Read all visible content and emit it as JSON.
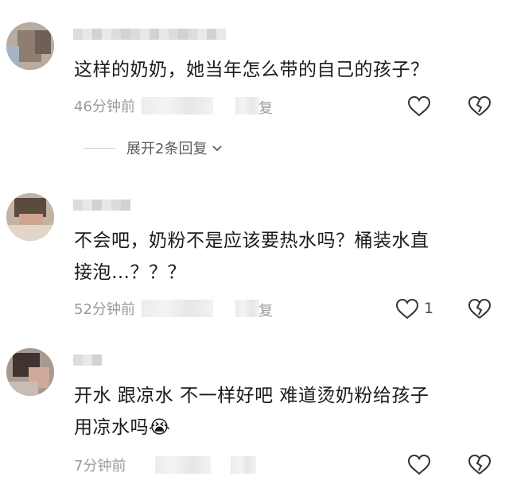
{
  "comments": [
    {
      "text_lines": [
        "这样的奶奶，她当年怎么带的自己的孩子？"
      ],
      "time": "46分钟前",
      "reply_tail": "复",
      "like_count": "",
      "expand_label": "展开2条回复"
    },
    {
      "text_lines": [
        "不会吧，奶粉不是应该要热水吗？桶装水直",
        "接泡…？？？"
      ],
      "time": "52分钟前",
      "reply_tail": "复",
      "like_count": "1"
    },
    {
      "text_lines": [
        "开水 跟凉水 不一样好吧 难道烫奶粉给孩子",
        "用凉水吗"
      ],
      "emoji": "😭",
      "time": "7分钟前",
      "like_count": ""
    }
  ],
  "icons": {
    "like": "heart-outline-icon",
    "dislike": "broken-heart-icon",
    "expand": "chevron-down-icon"
  },
  "colors": {
    "text": "#1b1b1b",
    "meta": "#9b9b9b",
    "icon": "#333333"
  }
}
